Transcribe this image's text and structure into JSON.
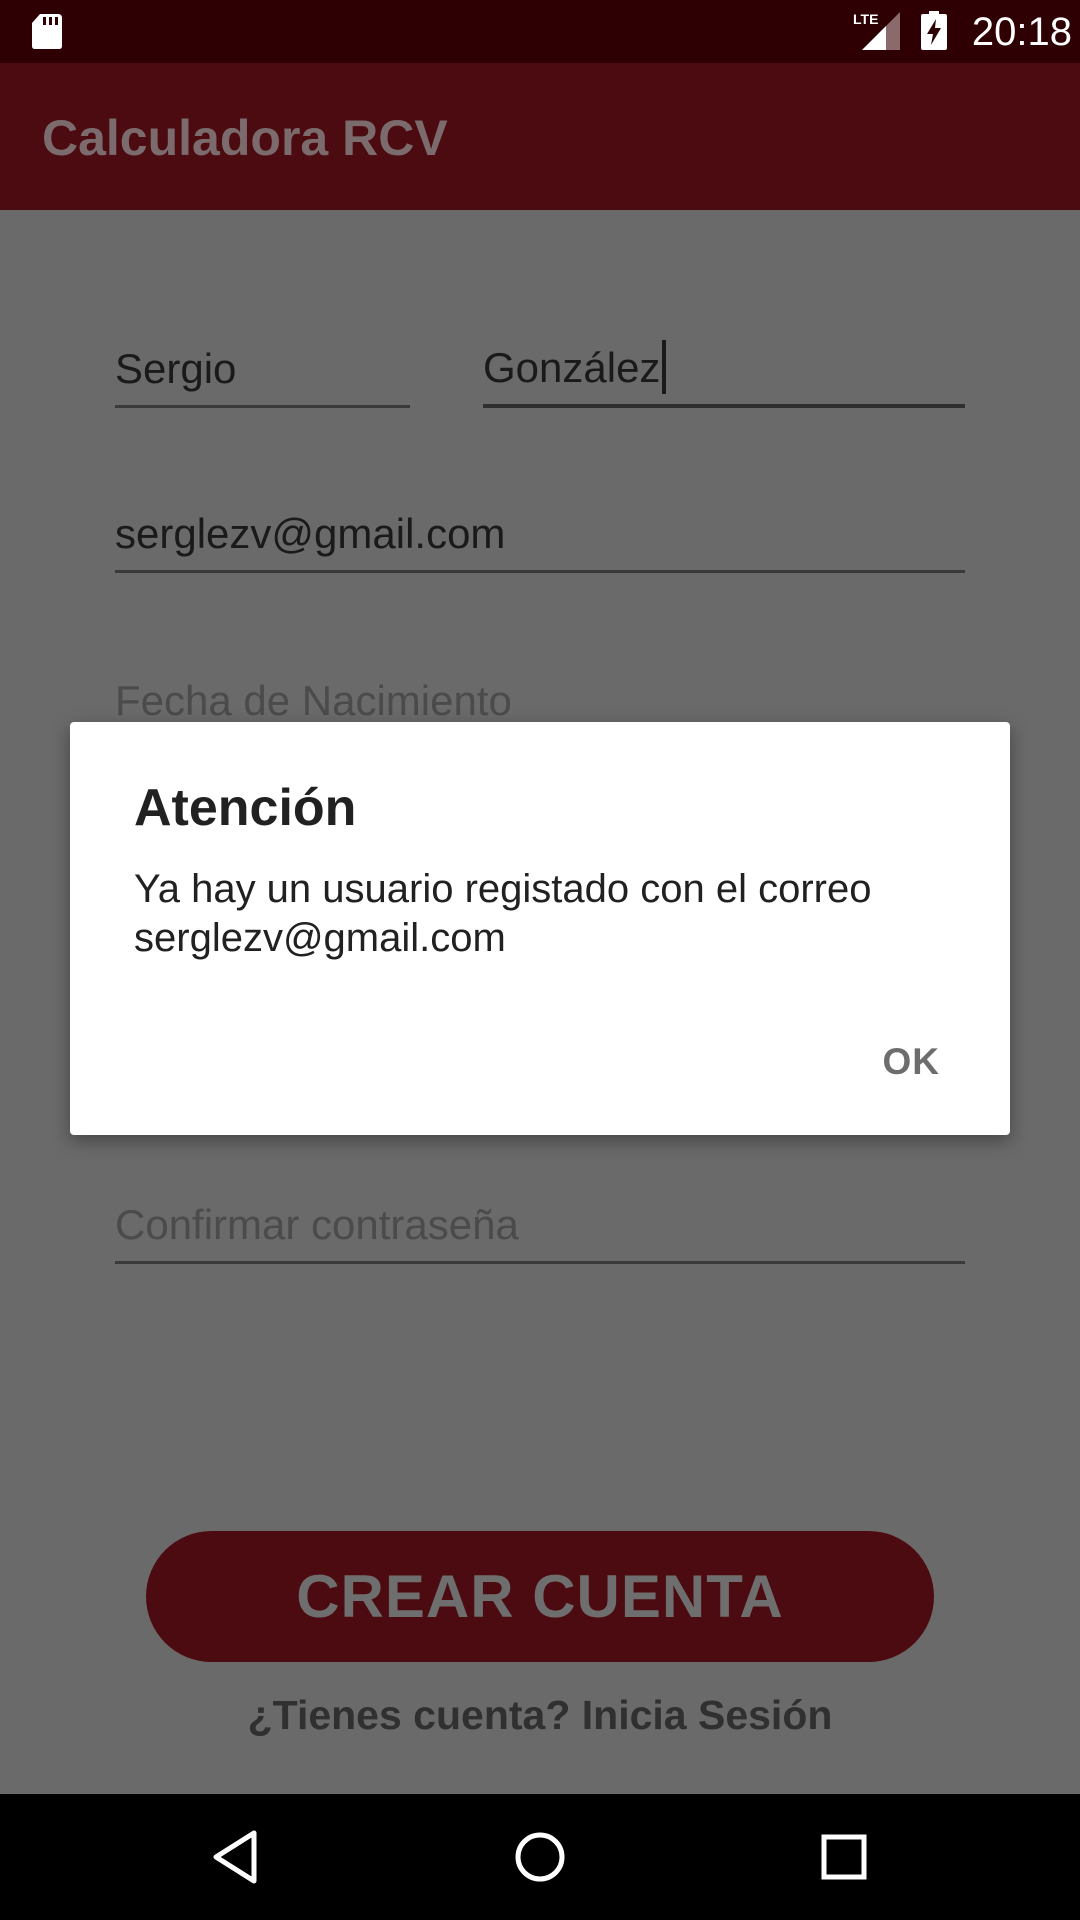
{
  "status_bar": {
    "time": "20:18",
    "network_label": "LTE",
    "icons": [
      "sd-card-icon",
      "lte-signal-icon",
      "battery-charging-icon"
    ]
  },
  "app_bar": {
    "title": "Calculadora RCV"
  },
  "form": {
    "first_name": {
      "value": "Sergio"
    },
    "last_name": {
      "value": "González"
    },
    "email": {
      "value": "serglezv@gmail.com"
    },
    "birth_date": {
      "placeholder": "Fecha de Nacimiento"
    },
    "confirm_password": {
      "placeholder": "Confirmar contraseña"
    },
    "create_button_label": "CREAR CUENTA",
    "login_link": "¿Tienes cuenta? Inicia Sesión"
  },
  "dialog": {
    "title": "Atención",
    "message_line_1": "Ya hay un usuario registado con el correo",
    "message_line_2": "serglezv@gmail.com",
    "ok_label": "OK"
  },
  "nav_bar": {
    "icons": [
      "back-icon",
      "home-icon",
      "recents-icon"
    ]
  },
  "colors": {
    "status_bar": "#2e0003",
    "app_bar": "#4b0b10",
    "scrim_background": "#6a6a6a",
    "dialog_background": "#ffffff",
    "button": "#4b0b10"
  }
}
